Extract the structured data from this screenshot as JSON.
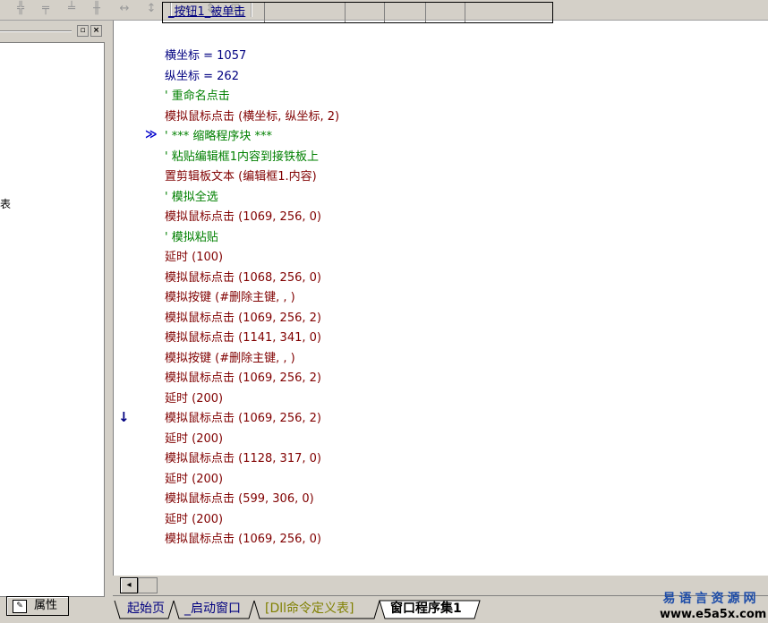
{
  "toolbar": {
    "buttons": [
      "align-left-icon",
      "align-center-icon",
      "align-top-icon",
      "align-middle-icon",
      "space-horizontal-icon",
      "space-vertical-icon",
      "same-width-icon",
      "same-height-icon",
      "same-size-icon"
    ],
    "glyphs": [
      "╬",
      "╤",
      "╧",
      "╫",
      "↔",
      "↕",
      "⇔",
      "⇕",
      "⊞"
    ]
  },
  "left_panel": {
    "visible_text": "表",
    "btn_restore": "▫",
    "btn_close": "×"
  },
  "props_tab": {
    "label": "属性"
  },
  "table_header": {
    "cells": [
      "_按钮1_被单击",
      "",
      "",
      "",
      "",
      ""
    ]
  },
  "code": [
    {
      "text": "横坐标 = 1057",
      "color": "blue"
    },
    {
      "text": "纵坐标 = 262",
      "color": "blue"
    },
    {
      "text": "' 重命名点击",
      "color": "green"
    },
    {
      "text": "模拟鼠标点击 (横坐标, 纵坐标, 2)",
      "color": "red"
    },
    {
      "text": "' *** 缩略程序块 ***",
      "color": "green"
    },
    {
      "text": "' 粘贴编辑框1内容到接铁板上",
      "color": "green"
    },
    {
      "text": "置剪辑板文本 (编辑框1.内容)",
      "color": "red"
    },
    {
      "text": "' 模拟全选",
      "color": "green"
    },
    {
      "text": "模拟鼠标点击 (1069, 256, 0)",
      "color": "red"
    },
    {
      "text": "' 模拟粘贴",
      "color": "green"
    },
    {
      "text": "延时 (100)",
      "color": "red"
    },
    {
      "text": "模拟鼠标点击 (1068, 256, 0)",
      "color": "red"
    },
    {
      "text": "模拟按键 (#删除主键, , )",
      "color": "red"
    },
    {
      "text": "模拟鼠标点击 (1069, 256, 2)",
      "color": "red"
    },
    {
      "text": "模拟鼠标点击 (1141, 341, 0)",
      "color": "red"
    },
    {
      "text": "模拟按键 (#删除主键, , )",
      "color": "red"
    },
    {
      "text": "模拟鼠标点击 (1069, 256, 2)",
      "color": "red"
    },
    {
      "text": "延时 (200)",
      "color": "red"
    },
    {
      "text": "模拟鼠标点击 (1069, 256, 2)",
      "color": "red"
    },
    {
      "text": "延时 (200)",
      "color": "red"
    },
    {
      "text": "模拟鼠标点击 (1128, 317, 0)",
      "color": "red"
    },
    {
      "text": "延时 (200)",
      "color": "red"
    },
    {
      "text": "模拟鼠标点击 (599, 306, 0)",
      "color": "red"
    },
    {
      "text": "延时 (200)",
      "color": "red"
    },
    {
      "text": "模拟鼠标点击 (1069, 256, 0)",
      "color": "red"
    }
  ],
  "markers": {
    "collapsed": "≫",
    "breakpoint_arrow": "↓"
  },
  "scrollbar": {
    "left_arrow": "◂"
  },
  "tabs": [
    {
      "label": "起始页",
      "active": false,
      "color": "#000080"
    },
    {
      "label": "_启动窗口",
      "active": false,
      "color": "#000080"
    },
    {
      "label": "[Dll命令定义表]",
      "active": false,
      "color": "#808000"
    },
    {
      "label": "窗口程序集1",
      "active": true,
      "color": "#000000"
    }
  ],
  "logo": {
    "cn": "易语言资源网",
    "url": "www.e5a5x.com"
  }
}
